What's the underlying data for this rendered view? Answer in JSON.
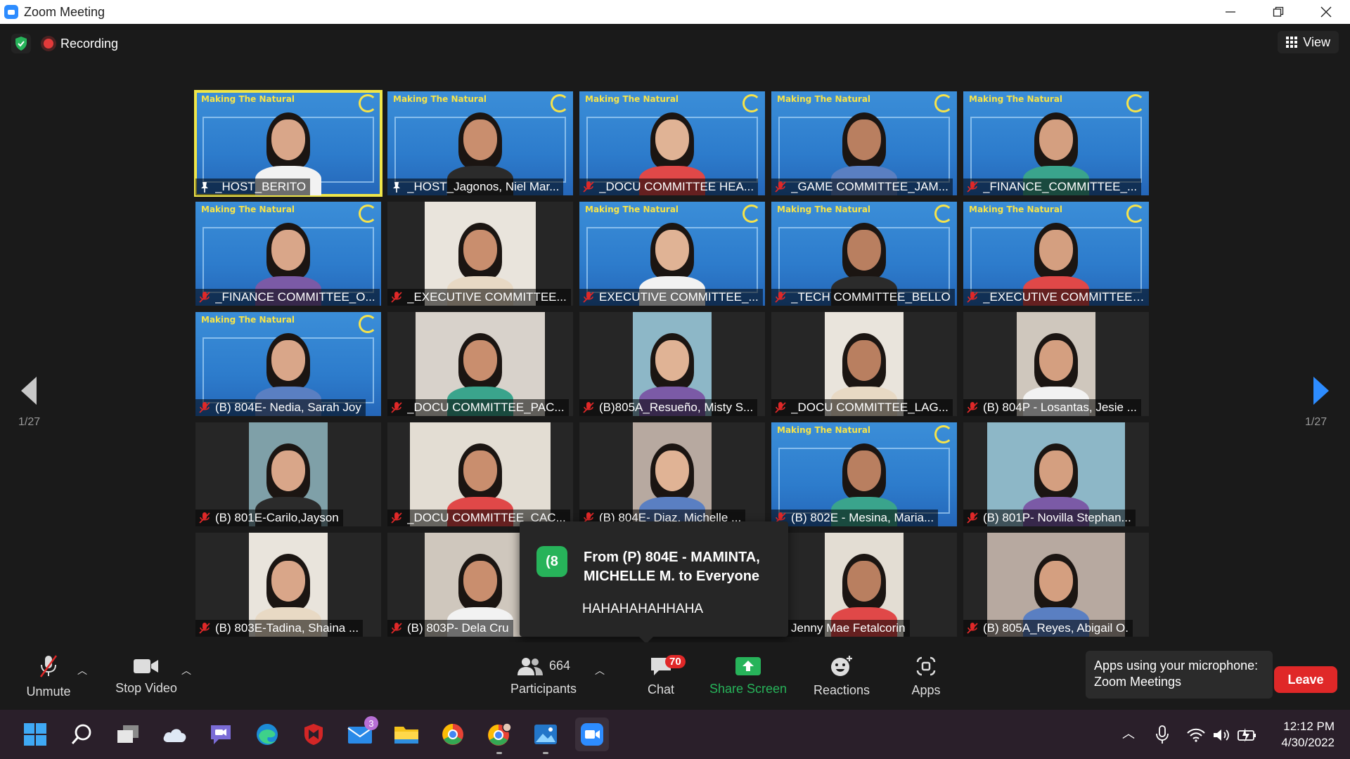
{
  "window": {
    "title": "Zoom Meeting"
  },
  "meeting": {
    "recording_label": "Recording",
    "view_label": "View",
    "page_left": "1/27",
    "page_right": "1/27"
  },
  "participants": [
    {
      "name": "_HOST_BERITO",
      "bg": "blue",
      "host": true,
      "active": true
    },
    {
      "name": "_HOST_Jagonos, Niel Mar...",
      "bg": "blue",
      "host": true
    },
    {
      "name": "_DOCU COMMITTEE HEA...",
      "bg": "blue"
    },
    {
      "name": "_GAME COMMITTEE_JAM...",
      "bg": "blue"
    },
    {
      "name": "_FINANCE_COMMITTEE_...",
      "bg": "blue"
    },
    {
      "name": "_FINANCE COMMITTEE_O...",
      "bg": "blue"
    },
    {
      "name": "_EXECUTIVE COMMITTEE...",
      "bg": "cam"
    },
    {
      "name": "EXECUTIVE COMMITTEE_...",
      "bg": "blue"
    },
    {
      "name": "_TECH COMMITTEE_BELLO",
      "bg": "blue"
    },
    {
      "name": "_EXECUTIVE COMMITTEE ...",
      "bg": "blue"
    },
    {
      "name": "(B) 804E- Nedia, Sarah Joy",
      "bg": "blue"
    },
    {
      "name": "_DOCU COMMITTEE_PAC...",
      "bg": "cam"
    },
    {
      "name": "(B)805A_Resueño, Misty S...",
      "bg": "cam"
    },
    {
      "name": "_DOCU COMMITTEE_LAG...",
      "bg": "cam"
    },
    {
      "name": "(B) 804P - Losantas, Jesie ...",
      "bg": "cam"
    },
    {
      "name": "(B) 801E-Carilo,Jayson",
      "bg": "cam"
    },
    {
      "name": "_DOCU COMMITTEE_CAC...",
      "bg": "cam"
    },
    {
      "name": "(B) 804E- Diaz, Michelle ...",
      "bg": "cam"
    },
    {
      "name": "(B) 802E - Mesina, Maria...",
      "bg": "blue"
    },
    {
      "name": "(B) 801P- Novilla Stephan...",
      "bg": "cam"
    },
    {
      "name": "(B) 803E-Tadina, Shaina ...",
      "bg": "cam"
    },
    {
      "name": "(B) 803P- Dela Cru",
      "bg": "cam"
    },
    {
      "name": "",
      "bg": "cam"
    },
    {
      "name": "Jenny Mae Fetalcorin",
      "bg": "cam"
    },
    {
      "name": "(B) 805A_Reyes, Abigail O.",
      "bg": "cam"
    }
  ],
  "banner_text": "Making The Natural",
  "chat_popup": {
    "avatar": "(8",
    "from": "From (P) 804E - MAMINTA, MICHELLE M. to Everyone",
    "message": "HAHAHAHAHHAHA"
  },
  "toolbar": {
    "unmute": "Unmute",
    "stop_video": "Stop Video",
    "participants_count": "664",
    "participants": "Participants",
    "chat": "Chat",
    "chat_badge": "70",
    "share_screen": "Share Screen",
    "reactions": "Reactions",
    "apps": "Apps",
    "mic_toast_line1": "Apps using your microphone:",
    "mic_toast_line2": "Zoom Meetings",
    "leave": "Leave"
  },
  "taskbar": {
    "mail_badge": "3",
    "time": "12:12 PM",
    "date": "4/30/2022"
  },
  "colors": {
    "accent": "#2D8CFF",
    "leave": "#E02828",
    "share": "#27B35A",
    "active_speaker": "#F0E64A"
  }
}
